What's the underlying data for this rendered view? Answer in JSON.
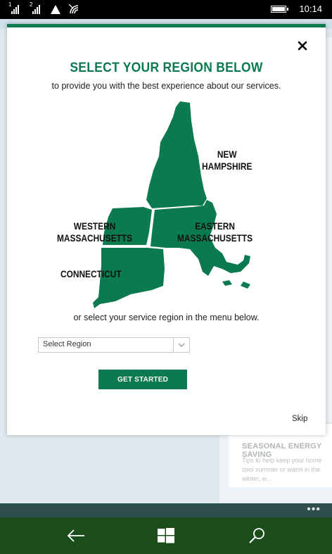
{
  "status_bar": {
    "sim1_label": "1",
    "sim2_label": "2",
    "time": "10:14",
    "icons": [
      "signal-icon",
      "signal-icon",
      "network-triangle-icon",
      "wifi-icon",
      "battery-icon"
    ]
  },
  "modal": {
    "title": "SELECT YOUR REGION BELOW",
    "subtitle": "to provide you with the best experience about our services.",
    "regions": {
      "new_hampshire": "NEW\nHAMPSHIRE",
      "western_massachusetts": "WESTERN\nMASSACHUSETTS",
      "eastern_massachusetts": "EASTERN\nMASSACHUSETTS",
      "connecticut": "CONNECTICUT"
    },
    "or_text": "or select your service region in the menu below.",
    "select": {
      "selected": "Select Region"
    },
    "get_started_label": "GET STARTED",
    "skip_label": "Skip",
    "map_color": "#0b7a4f"
  },
  "background": {
    "card_title": "SEASONAL ENERGY SAVING",
    "card_text": "Tips to help keep your home cool summer or warm in the winter, w..."
  },
  "app_bar": {
    "more_label": "•••"
  }
}
